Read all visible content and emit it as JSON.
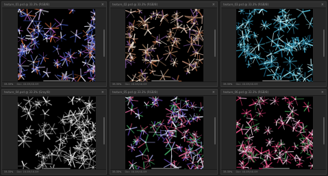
{
  "windows": [
    {
      "id": "win1",
      "tab_title": "texture_01.psd @ 33.3% (RGB/8)",
      "close_glyph": "×",
      "zoom": "33.33%",
      "doc_info": "Doc: 48.0M/48.0M",
      "palette": [
        "#3a4fb0",
        "#8a4aa0",
        "#d06a40",
        "#b0a0d0",
        "#5a6ad0",
        "#e0e0f0"
      ]
    },
    {
      "id": "win2",
      "tab_title": "texture_02.psd @ 33.3% (RGB/8)",
      "close_glyph": "×",
      "zoom": "33.33%",
      "doc_info": "Doc: 48.0M/48.0M",
      "palette": [
        "#a06040",
        "#c08870",
        "#704a8a",
        "#d0b0a0",
        "#8a6a50",
        "#f0e0d0"
      ]
    },
    {
      "id": "win3",
      "tab_title": "texture_03.psd @ 33.3% (RGB/8)",
      "close_glyph": "×",
      "zoom": "33.33%",
      "doc_info": "Doc: 48.0M/48.0M",
      "palette": [
        "#2a8aa8",
        "#4ab0c8",
        "#1a6080",
        "#80d0e0",
        "#3a9ab8",
        "#c0f0f8"
      ]
    },
    {
      "id": "win4",
      "tab_title": "texture_04.psd @ 33.3% (Gray/8)",
      "close_glyph": "×",
      "zoom": "33.33%",
      "doc_info": "Doc: 16.0M/16.0M",
      "palette": [
        "#909090",
        "#b0b0b0",
        "#707070",
        "#d0d0d0",
        "#a0a0a0",
        "#f0f0f0"
      ]
    },
    {
      "id": "win5",
      "tab_title": "texture_05.psd @ 33.3% (RGB/8)",
      "close_glyph": "×",
      "zoom": "33.33%",
      "doc_info": "Doc: 48.0M/48.0M",
      "palette": [
        "#6a4ac0",
        "#c04a6a",
        "#40a060",
        "#a0a0e0",
        "#d06090",
        "#e0e0f0"
      ]
    },
    {
      "id": "win6",
      "tab_title": "texture_06.psd @ 33.3% (RGB/8)",
      "close_glyph": "×",
      "zoom": "33.33%",
      "doc_info": "Doc: 48.0M/48.0M",
      "palette": [
        "#c03060",
        "#e05080",
        "#3a8a4a",
        "#d0a0c0",
        "#a02050",
        "#f0d0e0"
      ]
    }
  ]
}
